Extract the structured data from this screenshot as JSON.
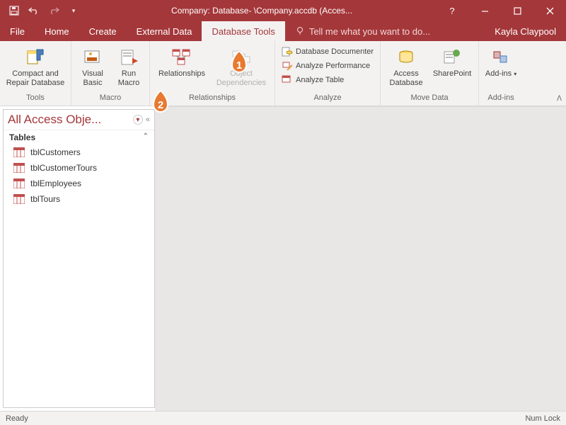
{
  "title": "Company: Database- \\Company.accdb (Acces...",
  "user": "Kayla Claypool",
  "tabs": {
    "file": "File",
    "home": "Home",
    "create": "Create",
    "external": "External Data",
    "dbtools": "Database Tools",
    "tell": "Tell me what you want to do..."
  },
  "ribbon": {
    "tools": {
      "label": "Tools",
      "compact": "Compact and Repair Database"
    },
    "macro": {
      "label": "Macro",
      "visual": "Visual Basic",
      "run": "Run Macro"
    },
    "relationships": {
      "label": "Relationships",
      "rel": "Relationships",
      "obj": "Object Dependencies"
    },
    "analyze": {
      "label": "Analyze",
      "doc": "Database Documenter",
      "perf": "Analyze Performance",
      "table": "Analyze Table"
    },
    "move": {
      "label": "Move Data",
      "access": "Access Database",
      "sp": "SharePoint"
    },
    "addins": {
      "label": "Add-ins",
      "btn": "Add-ins"
    }
  },
  "nav": {
    "title": "All Access Obje...",
    "section": "Tables",
    "items": [
      "tblCustomers",
      "tblCustomerTours",
      "tblEmployees",
      "tblTours"
    ]
  },
  "status": {
    "left": "Ready",
    "right": "Num Lock"
  },
  "callouts": {
    "one": "1",
    "two": "2"
  }
}
